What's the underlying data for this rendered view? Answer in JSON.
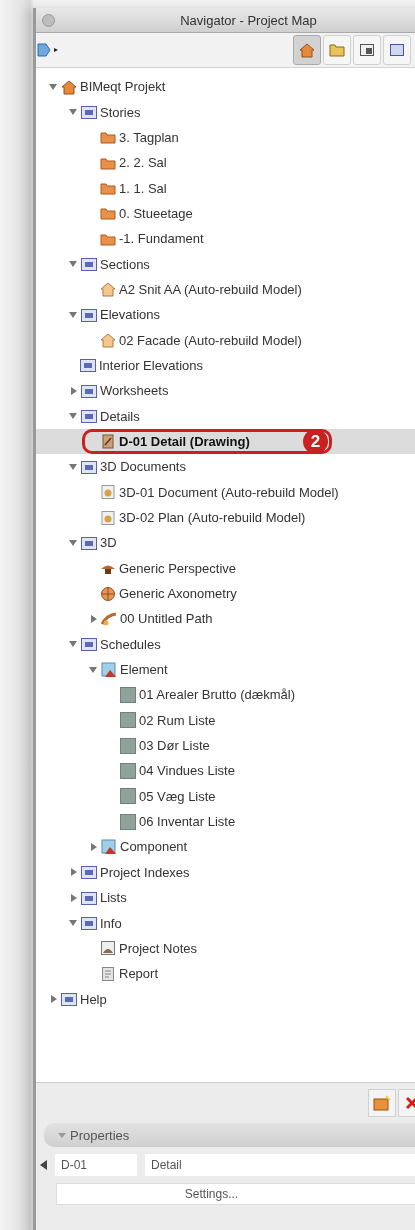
{
  "window": {
    "title": "Navigator - Project Map"
  },
  "toolbar": {
    "views": [
      {
        "kind": "house",
        "selected": true
      },
      {
        "kind": "folder",
        "selected": false
      },
      {
        "kind": "window",
        "selected": false
      },
      {
        "kind": "tag",
        "selected": false
      }
    ]
  },
  "tree": [
    {
      "label": "BIMeqt Projekt",
      "kind": "project",
      "expanded": true,
      "selected": false,
      "children": [
        {
          "label": "Stories",
          "kind": "category",
          "expanded": true,
          "selected": false,
          "children": [
            {
              "label": "3. Tagplan",
              "kind": "story",
              "selected": false
            },
            {
              "label": "2. 2. Sal",
              "kind": "story",
              "selected": false
            },
            {
              "label": "1. 1. Sal",
              "kind": "story",
              "selected": false
            },
            {
              "label": "0. Stueetage",
              "kind": "story",
              "selected": false
            },
            {
              "label": "-1. Fundament",
              "kind": "story",
              "selected": false
            }
          ]
        },
        {
          "label": "Sections",
          "kind": "category",
          "expanded": true,
          "selected": false,
          "children": [
            {
              "label": "A2 Snit AA (Auto-rebuild Model)",
              "kind": "view",
              "selected": false
            }
          ]
        },
        {
          "label": "Elevations",
          "kind": "category",
          "expanded": true,
          "selected": false,
          "children": [
            {
              "label": "02 Facade (Auto-rebuild Model)",
              "kind": "view",
              "selected": false
            }
          ]
        },
        {
          "label": "Interior Elevations",
          "kind": "category",
          "selected": false
        },
        {
          "label": "Worksheets",
          "kind": "category",
          "expanded": false,
          "selected": false
        },
        {
          "label": "Details",
          "kind": "category",
          "expanded": true,
          "selected": false,
          "children": [
            {
              "label": "D-01 Detail (Drawing)",
              "kind": "detail",
              "selected": true
            }
          ]
        },
        {
          "label": "3D Documents",
          "kind": "category",
          "expanded": true,
          "selected": false,
          "children": [
            {
              "label": "3D-01 Document (Auto-rebuild Model)",
              "kind": "document",
              "selected": false
            },
            {
              "label": "3D-02 Plan (Auto-rebuild Model)",
              "kind": "document",
              "selected": false
            }
          ]
        },
        {
          "label": "3D",
          "kind": "category",
          "expanded": true,
          "selected": false,
          "children": [
            {
              "label": "Generic Perspective",
              "kind": "camera",
              "selected": false
            },
            {
              "label": "Generic Axonometry",
              "kind": "sphere",
              "selected": false
            },
            {
              "label": "00 Untitled Path",
              "kind": "path",
              "expanded": false,
              "selected": false
            }
          ]
        },
        {
          "label": "Schedules",
          "kind": "category",
          "expanded": true,
          "selected": false,
          "children": [
            {
              "label": "Element",
              "kind": "scheme",
              "expanded": true,
              "selected": false,
              "children": [
                {
                  "label": "01 Arealer Brutto (dækmål)",
                  "kind": "schedule",
                  "selected": false
                },
                {
                  "label": "02 Rum Liste",
                  "kind": "schedule",
                  "selected": false
                },
                {
                  "label": "03 Dør Liste",
                  "kind": "schedule",
                  "selected": false
                },
                {
                  "label": "04 Vindues Liste",
                  "kind": "schedule",
                  "selected": false
                },
                {
                  "label": "05 Væg Liste",
                  "kind": "schedule",
                  "selected": false
                },
                {
                  "label": "06 Inventar Liste",
                  "kind": "schedule",
                  "selected": false
                }
              ]
            },
            {
              "label": "Component",
              "kind": "scheme",
              "expanded": false,
              "selected": false
            }
          ]
        },
        {
          "label": "Project Indexes",
          "kind": "category",
          "expanded": false,
          "selected": false
        },
        {
          "label": "Lists",
          "kind": "category",
          "expanded": false,
          "selected": false
        },
        {
          "label": "Info",
          "kind": "category",
          "expanded": true,
          "selected": false,
          "children": [
            {
              "label": "Project Notes",
              "kind": "notes",
              "selected": false
            },
            {
              "label": "Report",
              "kind": "report",
              "selected": false
            }
          ]
        }
      ]
    },
    {
      "label": "Help",
      "kind": "category",
      "expanded": false,
      "selected": false
    }
  ],
  "callout": {
    "number": "2"
  },
  "properties": {
    "title": "Properties",
    "expanded": true,
    "id_value": "D-01",
    "name_value": "Detail",
    "settings_button": "Settings..."
  }
}
